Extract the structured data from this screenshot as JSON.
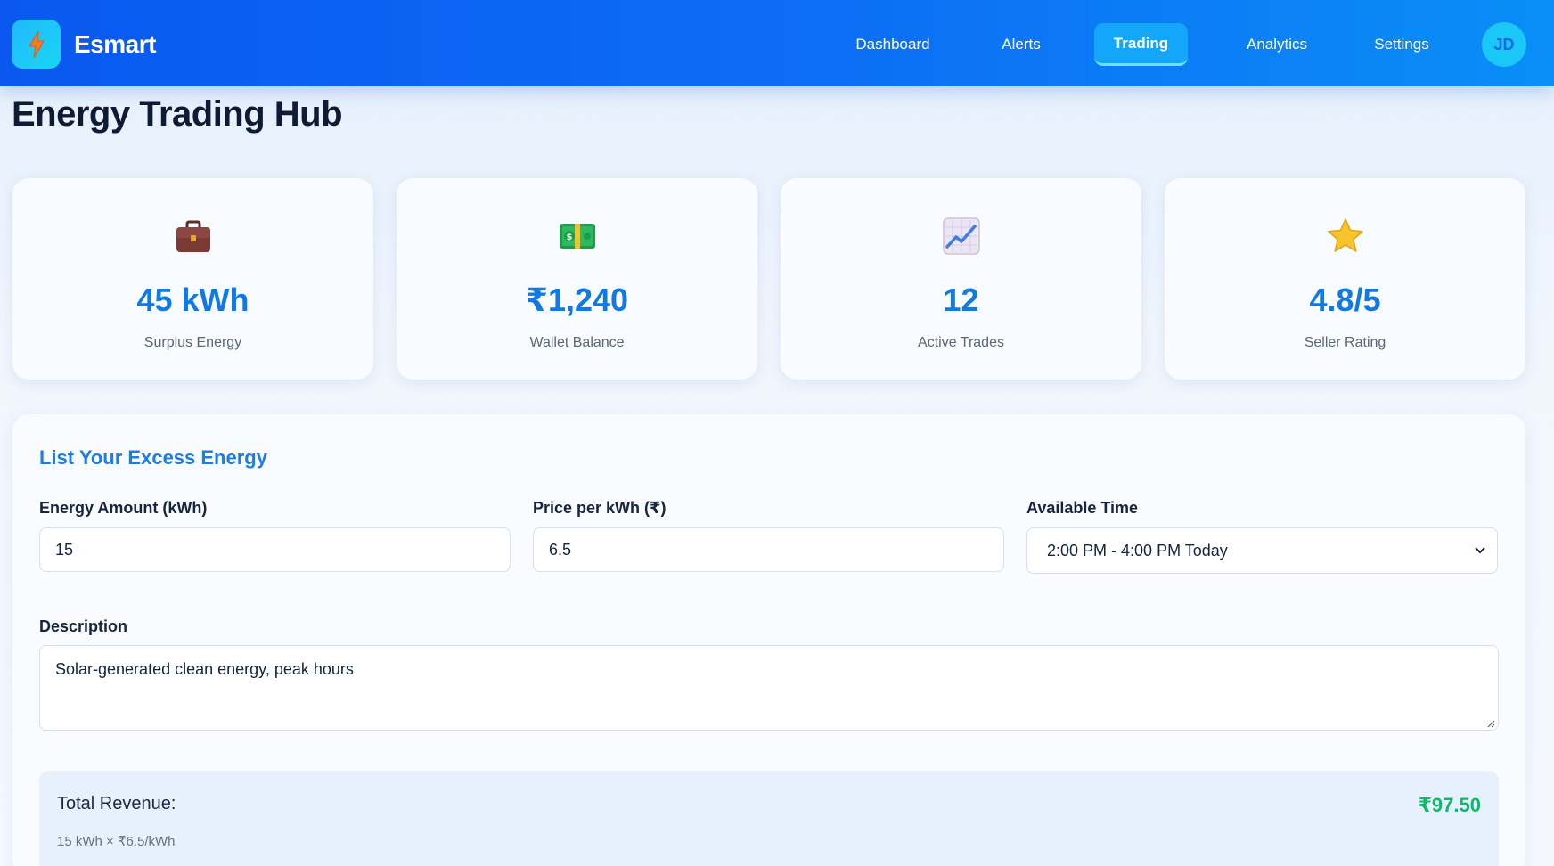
{
  "app": {
    "name": "Esmart",
    "avatar_initials": "JD"
  },
  "nav": {
    "items": [
      {
        "label": "Dashboard",
        "active": false
      },
      {
        "label": "Alerts",
        "active": false
      },
      {
        "label": "Trading",
        "active": true
      },
      {
        "label": "Analytics",
        "active": false
      },
      {
        "label": "Settings",
        "active": false
      }
    ]
  },
  "page": {
    "title": "Energy Trading Hub"
  },
  "stats": [
    {
      "icon": "briefcase-icon",
      "value": "45 kWh",
      "label": "Surplus Energy"
    },
    {
      "icon": "money-icon",
      "value": "₹1,240",
      "label": "Wallet Balance"
    },
    {
      "icon": "chart-increasing-icon",
      "value": "12",
      "label": "Active Trades"
    },
    {
      "icon": "star-icon",
      "value": "4.8/5",
      "label": "Seller Rating"
    }
  ],
  "listing": {
    "title": "List Your Excess Energy",
    "energy_amount": {
      "label": "Energy Amount (kWh)",
      "value": "15"
    },
    "price": {
      "label": "Price per kWh (₹)",
      "value": "6.5"
    },
    "available_time": {
      "label": "Available Time",
      "selected": "2:00 PM - 4:00 PM Today"
    },
    "description": {
      "label": "Description",
      "value": "Solar-generated clean energy, peak hours"
    },
    "revenue": {
      "label": "Total Revenue:",
      "value": "₹97.50",
      "formula": "15 kWh × ₹6.5/kWh"
    }
  },
  "colors": {
    "accent": "#1279e3",
    "nav_gradient_start": "#0a58f0",
    "nav_gradient_end": "#0a8ef7",
    "revenue_green": "#12b76a"
  }
}
